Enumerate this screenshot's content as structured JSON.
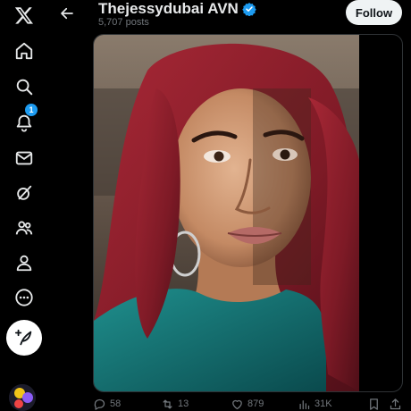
{
  "nav": {
    "items": [
      {
        "name": "x-logo-icon"
      },
      {
        "name": "home-icon"
      },
      {
        "name": "search-icon"
      },
      {
        "name": "notifications-icon",
        "badge": "1"
      },
      {
        "name": "messages-icon"
      },
      {
        "name": "grok-icon"
      },
      {
        "name": "communities-icon"
      },
      {
        "name": "profile-icon"
      },
      {
        "name": "more-icon"
      }
    ],
    "post_button_icon": "feather-plus-icon"
  },
  "header": {
    "title": "Thejessydubai AVN",
    "verified": true,
    "posts_count": "5,707 posts",
    "follow_label": "Follow"
  },
  "media": {
    "description_icon": "photo-image"
  },
  "actions": {
    "replies": "58",
    "reposts": "13",
    "likes": "879",
    "views": "31K"
  },
  "colors": {
    "background": "#000000",
    "text_primary": "#e7e9ea",
    "text_secondary": "#71767b",
    "accent": "#1d9bf0",
    "follow_bg": "#eff3f4"
  }
}
